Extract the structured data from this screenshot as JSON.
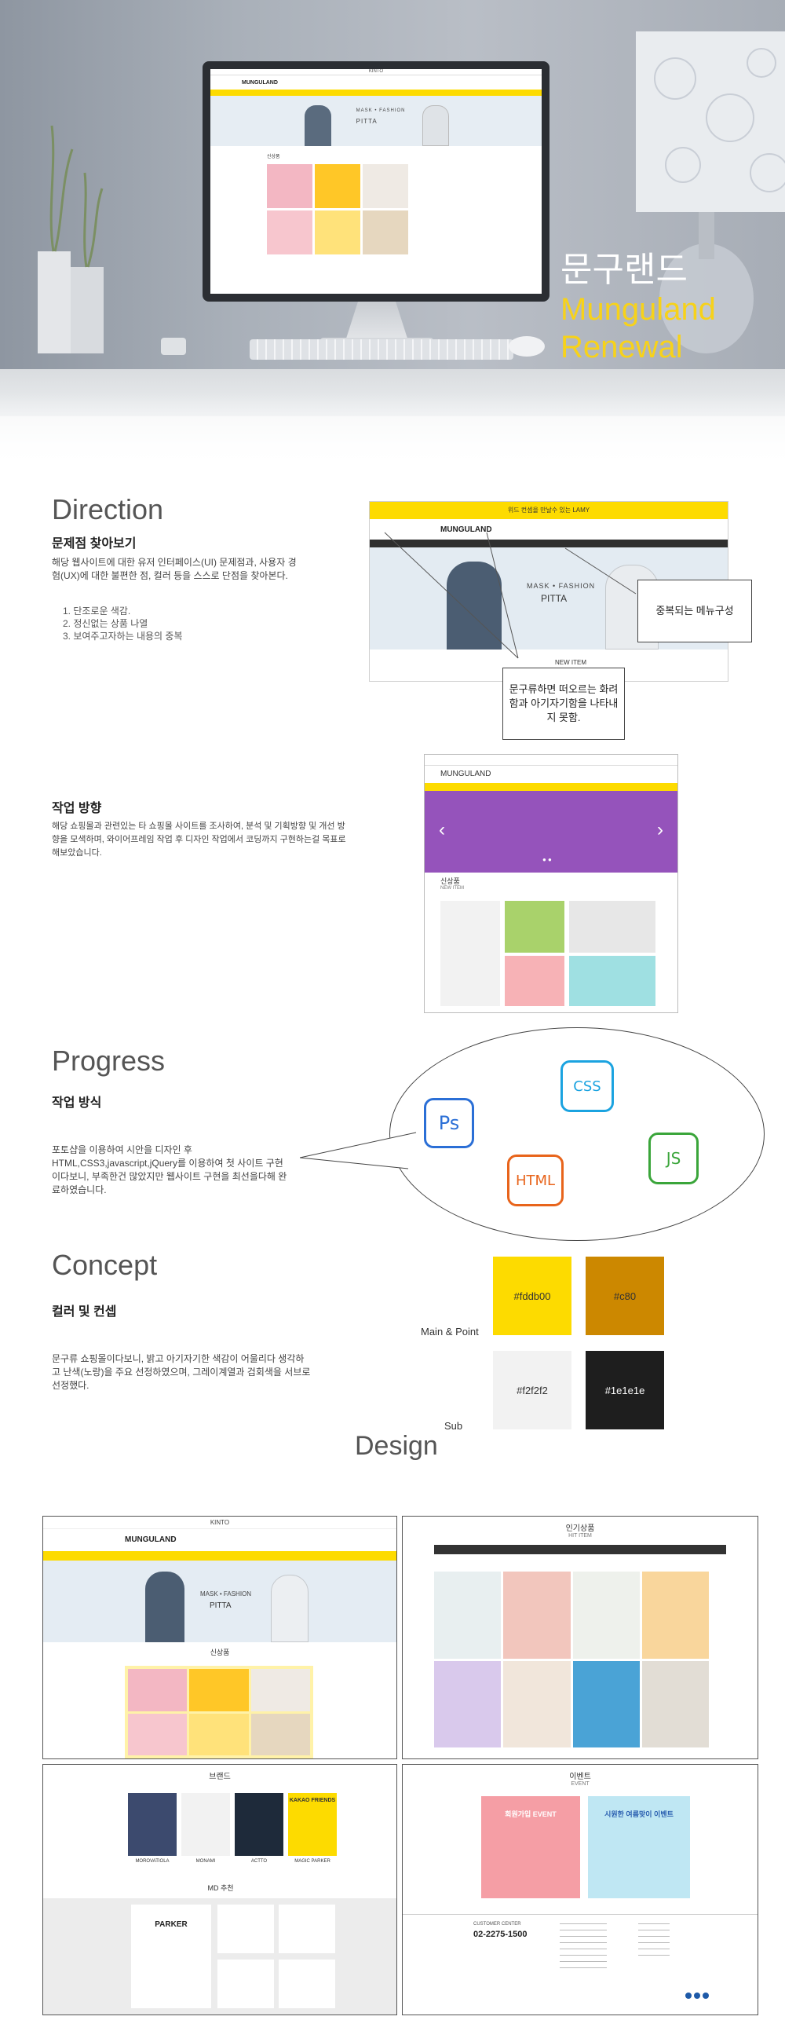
{
  "hero": {
    "title_kr": "문구랜드",
    "title_en_1": "Munguland",
    "title_en_2": "Renewal",
    "screen_top_text": "KINTO",
    "screen_logo": "MUNGULAND",
    "screen_banner_brand": "MASK • FASHION",
    "screen_banner_product": "PITTA",
    "screen_section": "신상품"
  },
  "direction": {
    "heading": "Direction",
    "subheading": "문제점 찾아보기",
    "paragraph": "해당 웹사이트에 대한 유저 인터페이스(UI) 문제점과, 사용자 경험(UX)에 대한 불편한 점, 컬러 등을 스스로 단점을 찾아본다.",
    "items": [
      "1. 단조로운 색감.",
      "2. 정신없는 상품 나열",
      "3. 보여주고자하는 내용의 중복"
    ],
    "callout_menu": "중복되는 메뉴구성",
    "callout_color": "문구류하면 떠오르는 화려함과 아기자기함을 나타내지 못함.",
    "shot_banner_text": "위드 컨셉을 만날수 있는 LAMY",
    "shot_logo": "MUNGULAND",
    "shot_brand": "MASK • FASHION",
    "shot_product": "PITTA",
    "shot_new_item": "NEW ITEM"
  },
  "plan": {
    "subheading": "작업 방향",
    "paragraph": "해당 쇼핑몰과 관련있는 타 쇼핑몰 사이트를 조사하여, 분석 및 기획방향 및 개선 방향을 모색하며, 와이어프레임 작업 후 디자인 작업에서 코딩까지 구현하는걸 목표로 해보았습니다.",
    "wire_logo": "MUNGULAND",
    "wire_section": "신상품",
    "wire_section_en": "NEW ITEM"
  },
  "progress": {
    "heading": "Progress",
    "subheading": "작업 방식",
    "paragraph": "포토샵을 이용하여 시안을 디자인 후 HTML,CSS3,javascript,jQuery를 이용하여 첫 사이트 구현이다보니, 부족한건 많았지만 웹사이트 구현을 최선을다해 완료하였습니다.",
    "icons": [
      {
        "name": "photoshop-icon",
        "label": "Ps",
        "color": "#2b6fd6"
      },
      {
        "name": "css-icon",
        "label": "CSS",
        "color": "#1ba3e0"
      },
      {
        "name": "html-icon",
        "label": "HTML",
        "color": "#e8641b"
      },
      {
        "name": "js-icon",
        "label": "JS",
        "color": "#3aa53a"
      }
    ]
  },
  "concept": {
    "heading": "Concept",
    "subheading": "컬러 및 컨셉",
    "paragraph": "문구류 쇼핑몰이다보니, 밝고 아기자기한 색감이 어울리다 생각하고 난색(노랑)을 주요 선정하였으며, 그레이계열과 검회색을 서브로 선정했다.",
    "main_label": "Main & Point",
    "sub_label": "Sub",
    "swatches": [
      {
        "label": "#fddb00",
        "color": "#fddb00",
        "text_color": "#333333"
      },
      {
        "label": "#c80",
        "color": "#cc8800",
        "text_color": "#333333"
      },
      {
        "label": "#f2f2f2",
        "color": "#f2f2f2",
        "text_color": "#333333"
      },
      {
        "label": "#1e1e1e",
        "color": "#1e1e1e",
        "text_color": "#ffffff"
      }
    ]
  },
  "design": {
    "heading": "Design",
    "card1_top": "KINTO",
    "card1_logo": "MUNGULAND",
    "card1_brand": "MASK • FASHION",
    "card1_product": "PITTA",
    "card1_section": "신상품",
    "card2_title": "인기상품",
    "card2_sub": "HIT ITEM",
    "card3_title": "브랜드",
    "card3_brands": [
      "MOROVATIOLA",
      "MONAMI",
      "ACTTO",
      "MAGIC PARKER"
    ],
    "card3_kakao": "KAKAO FRIENDS",
    "card3_md": "MD 추천",
    "card3_parker": "PARKER",
    "card4_title": "이벤트",
    "card4_sub": "EVENT",
    "card4_event1": "회원가입 EVENT",
    "card4_event2": "시원한 여름맞이 이벤트",
    "card4_phone": "02-2275-1500",
    "card4_center": "CUSTOMER CENTER"
  }
}
